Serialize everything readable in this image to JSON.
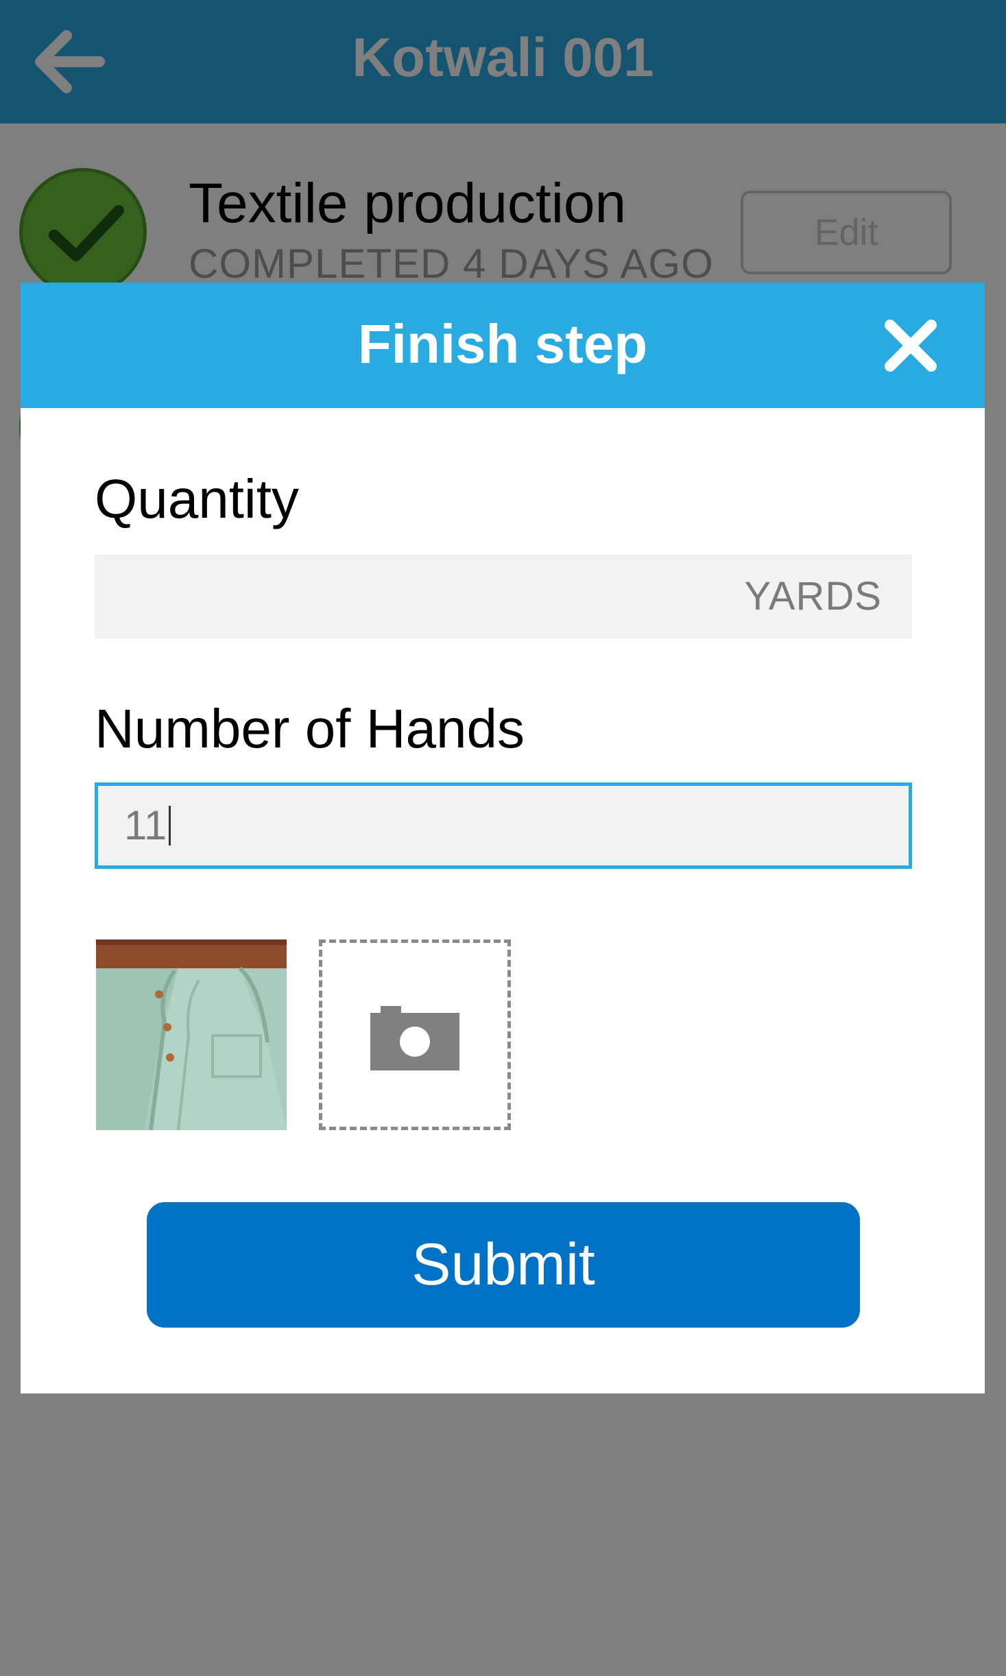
{
  "header": {
    "title": "Kotwali 001"
  },
  "step": {
    "title": "Textile production",
    "status": "COMPLETED 4 DAYS AGO",
    "edit_label": "Edit"
  },
  "modal": {
    "title": "Finish step",
    "quantity": {
      "label": "Quantity",
      "value": "",
      "unit": "YARDS"
    },
    "hands": {
      "label": "Number of Hands",
      "value": "11"
    },
    "submit_label": "Submit"
  },
  "colors": {
    "header": "#29a9e0",
    "modal_header": "#29abe2",
    "submit": "#0072c6",
    "check": "#6fbf3a",
    "focus_border": "#29abe2"
  },
  "icons": {
    "back": "arrow-left-icon",
    "close": "close-icon",
    "camera": "camera-icon",
    "check": "checkmark-icon"
  }
}
